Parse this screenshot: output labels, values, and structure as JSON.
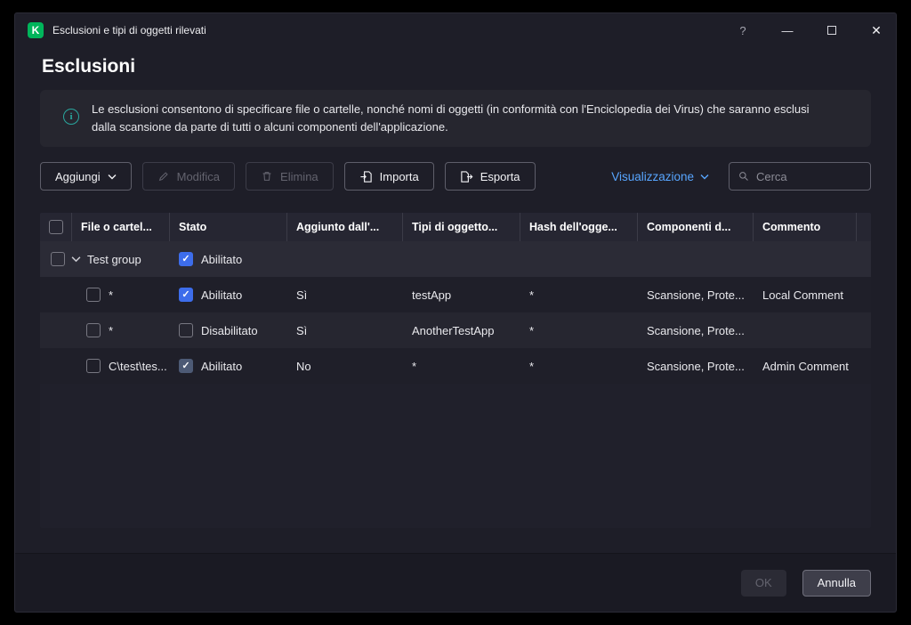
{
  "colors": {
    "brand-green": "#00B55B",
    "accent-blue": "#3D6DEB",
    "link-blue": "#58A6FF",
    "info-teal": "#2AA79F"
  },
  "icons": {
    "logo": "K",
    "help": "?",
    "minimize": "—",
    "close": "✕"
  },
  "window": {
    "title": "Esclusioni e tipi di oggetti rilevati"
  },
  "page": {
    "title": "Esclusioni"
  },
  "banner": {
    "text": "Le esclusioni consentono di specificare file o cartelle, nonché nomi di oggetti (in conformità con l'Enciclopedia dei Virus) che saranno esclusi dalla scansione da parte di tutti o alcuni componenti dell'applicazione."
  },
  "toolbar": {
    "add": "Aggiungi",
    "edit": "Modifica",
    "delete": "Elimina",
    "import": "Importa",
    "export": "Esporta",
    "view": "Visualizzazione",
    "search_placeholder": "Cerca"
  },
  "table": {
    "headers": [
      "File o cartel...",
      "Stato",
      "Aggiunto dall'...",
      "Tipi di oggetto...",
      "Hash dell'ogge...",
      "Componenti d...",
      "Commento"
    ],
    "group": {
      "name": "Test group",
      "status": "Abilitato",
      "checked": true
    },
    "rows": [
      {
        "file": "*",
        "status": "Abilitato",
        "status_checked": true,
        "added_by": "Sì",
        "object_types": "testApp",
        "hash": "*",
        "components": "Scansione, Prote...",
        "comment": "Local Comment"
      },
      {
        "file": "*",
        "status": "Disabilitato",
        "status_checked": false,
        "added_by": "Sì",
        "object_types": "AnotherTestApp",
        "hash": "*",
        "components": "Scansione, Prote...",
        "comment": ""
      },
      {
        "file": "C\\test\\tes...",
        "status": "Abilitato",
        "status_checked": true,
        "status_muted": true,
        "added_by": "No",
        "object_types": "*",
        "hash": "*",
        "components": "Scansione, Prote...",
        "comment": "Admin Comment"
      }
    ]
  },
  "footer": {
    "ok": "OK",
    "cancel": "Annulla"
  }
}
